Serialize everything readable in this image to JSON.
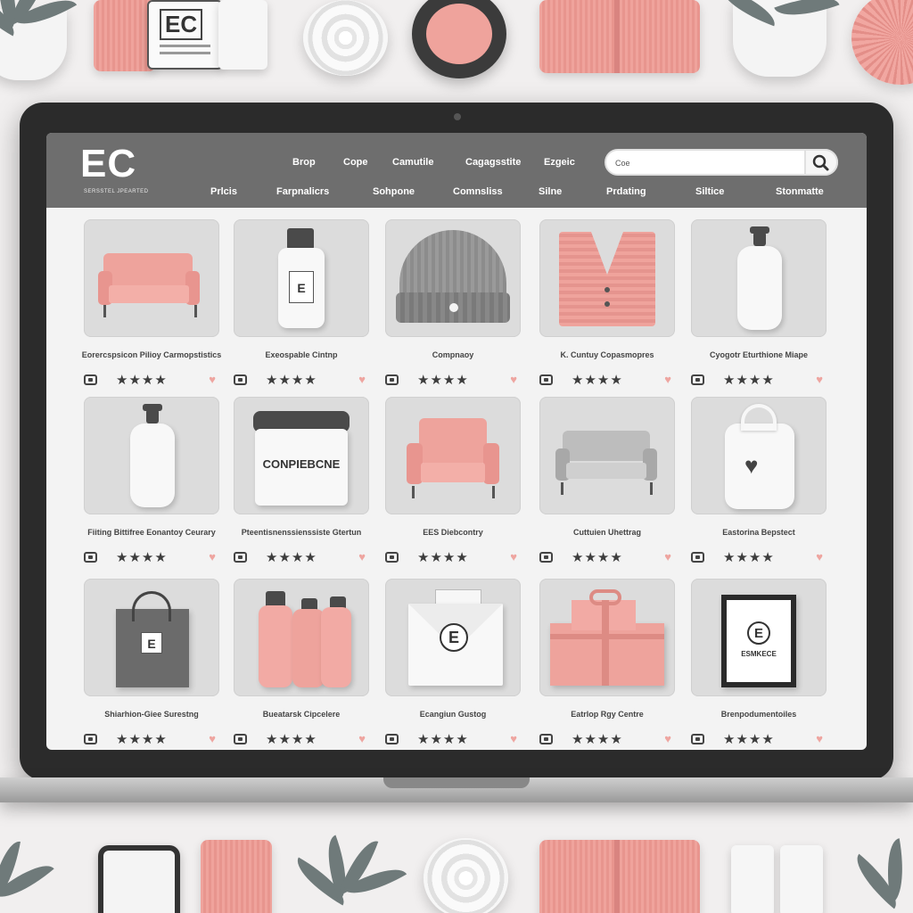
{
  "brand": {
    "logo": "EC",
    "tagline": "SERSSTEL JPEARTED"
  },
  "nav_top": [
    "Brop",
    "Cope",
    "Camutile",
    "Cagagsstite",
    "Ezgeic"
  ],
  "nav_bottom": [
    "Prlcis",
    "Farpnalicrs",
    "Sohpone",
    "Comnsliss",
    "Silne",
    "Prdating",
    "Siltice",
    "Stonmatte"
  ],
  "search": {
    "value": "Coe",
    "icon": "search-icon"
  },
  "products": [
    {
      "title": "Eorercspsicon Pilioy Carmopstistics",
      "art": "pink-sofa",
      "rating": 4
    },
    {
      "title": "Exeospable Cintnp",
      "art": "white-bottle",
      "rating": 4
    },
    {
      "title": "Compnaoy",
      "art": "grey-beanie",
      "rating": 4
    },
    {
      "title": "K. Cuntuy Copasmopres",
      "art": "pink-cardigan",
      "rating": 4
    },
    {
      "title": "Cyogotr Eturthione Miape",
      "art": "pump-bottle",
      "rating": 4
    },
    {
      "title": "Fiiting Bittifree Eonantoy Ceurary",
      "art": "pump-bottle",
      "rating": 4
    },
    {
      "title": "Pteentisnenssienssiste Gtertun",
      "art": "cream-jar",
      "rating": 4
    },
    {
      "title": "EES Diebcontry",
      "art": "pink-armchair",
      "rating": 4
    },
    {
      "title": "Cuttuien Uhettrag",
      "art": "grey-sofa",
      "rating": 4
    },
    {
      "title": "Eastorina Bepstect",
      "art": "white-bag",
      "rating": 4
    },
    {
      "title": "Shiarhion-Giee Surestng",
      "art": "shopping-bag",
      "rating": 4
    },
    {
      "title": "Bueatarsk Cipcelere",
      "art": "pink-bottles",
      "rating": 4
    },
    {
      "title": "Ecangiun Gustog",
      "art": "envelope",
      "rating": 4
    },
    {
      "title": "Eatrlop Rgy Centre",
      "art": "gift-box",
      "rating": 4
    },
    {
      "title": "Brenpodumentoiles",
      "art": "frame",
      "rating": 4
    }
  ],
  "jar_label": "CONPIEBCNE",
  "frame_label": "ESMKECE",
  "stars_glyph": "★★★★",
  "colors": {
    "accent": "#efa39c",
    "header": "#6e6e6e",
    "bezel": "#2b2b2b",
    "thumb": "#dcdcdc"
  }
}
